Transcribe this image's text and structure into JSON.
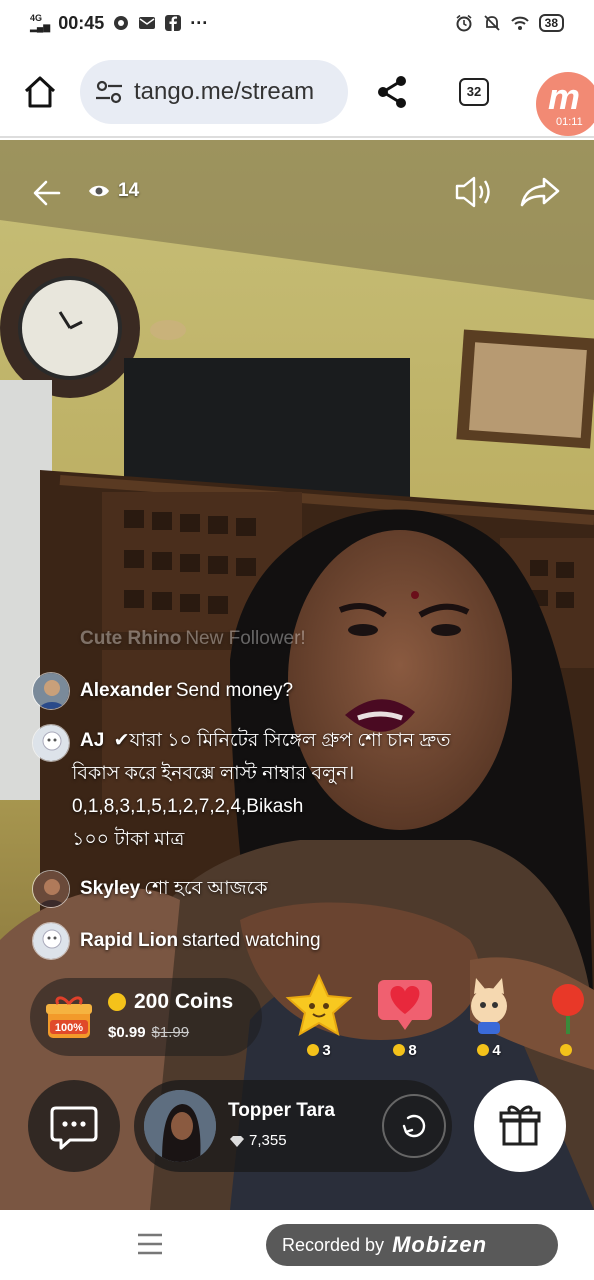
{
  "status_bar": {
    "network": "4G",
    "time": "00:45",
    "battery": "38"
  },
  "browser": {
    "url": "tango.me/stream",
    "tab_count": "32",
    "recording_time": "01:11"
  },
  "stream": {
    "viewer_count": "14",
    "chat": [
      {
        "name": "Cute Rhino",
        "text": "New Follower!"
      },
      {
        "name": "Alexander",
        "text": "Send money?"
      },
      {
        "name": "AJ",
        "lines": [
          "✔যারা ১০ মিনিটের সিঙ্গেল গ্রুপ শো চান দ্রুত",
          "বিকাস করে ইনবক্সে লাস্ট নাম্বার বলুন।",
          "0,1,8,3,1,5,1,2,7,2,4,Bikash",
          "১০০ টাকা মাত্র"
        ]
      },
      {
        "name": "Skyley",
        "text": "শো হবে আজকে"
      },
      {
        "name": "Rapid Lion",
        "text": "started watching"
      }
    ],
    "promo": {
      "badge": "100%",
      "coins": "200 Coins",
      "price": "$0.99",
      "old_price": "$1.99"
    },
    "gifts": [
      {
        "name": "star",
        "cost": "3"
      },
      {
        "name": "heart",
        "cost": "8"
      },
      {
        "name": "cat",
        "cost": "4"
      },
      {
        "name": "rose",
        "cost": ""
      }
    ],
    "host": {
      "name": "Topper Tara",
      "diamonds": "7,355"
    }
  },
  "recorder": {
    "label": "Recorded by",
    "brand": "Mobizen"
  }
}
